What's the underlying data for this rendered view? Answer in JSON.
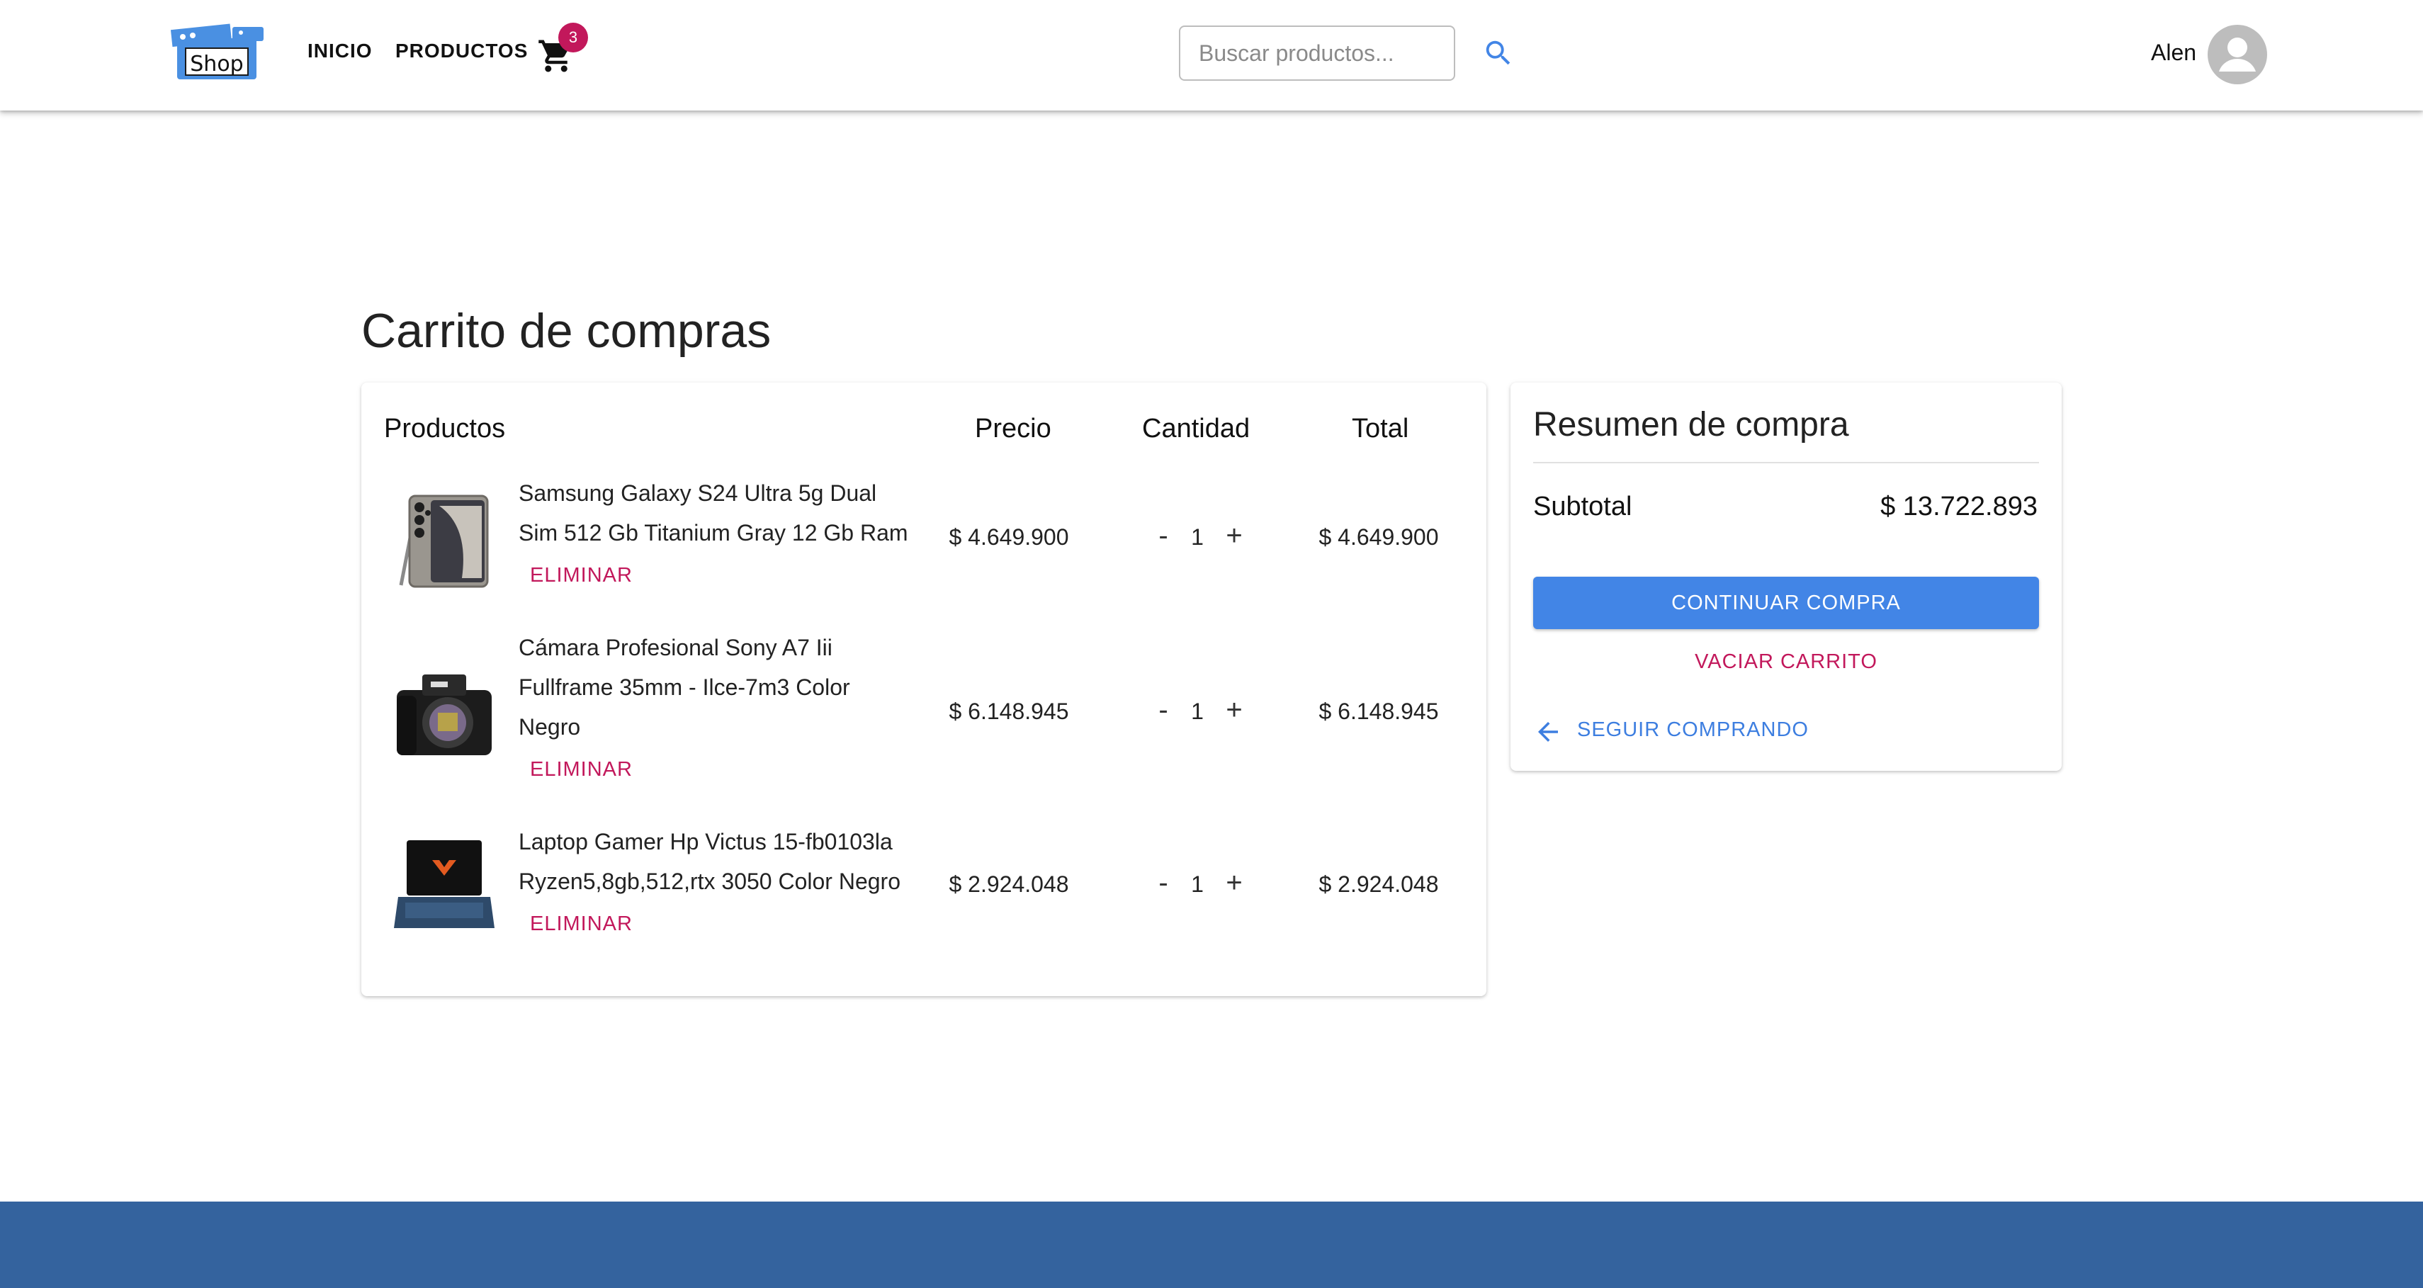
{
  "header": {
    "logo_text": "Shop",
    "nav": [
      {
        "label": "INICIO"
      },
      {
        "label": "PRODUCTOS"
      }
    ],
    "cart_count": "3",
    "search": {
      "placeholder": "Buscar productos...",
      "value": ""
    },
    "user_name": "Alen",
    "icons": {
      "cart": "shopping-cart-icon",
      "search": "search-icon",
      "avatar": "account-circle-icon"
    }
  },
  "page_title": "Carrito de compras",
  "cart_table": {
    "headers": {
      "product": "Productos",
      "price": "Precio",
      "quantity": "Cantidad",
      "total": "Total"
    },
    "remove_label": "ELIMINAR",
    "decrement_label": "-",
    "increment_label": "+",
    "items": [
      {
        "name": "Samsung Galaxy S24 Ultra 5g Dual Sim 512 Gb Titanium Gray 12 Gb Ram",
        "price": "$ 4.649.900",
        "quantity": "1",
        "total": "$ 4.649.900",
        "image": "phone-image"
      },
      {
        "name": "Cámara Profesional Sony A7 Iii Fullframe 35mm - Ilce-7m3 Color Negro",
        "price": "$ 6.148.945",
        "quantity": "1",
        "total": "$ 6.148.945",
        "image": "camera-image"
      },
      {
        "name": "Laptop Gamer Hp Victus 15-fb0103la Ryzen5,8gb,512,rtx 3050 Color Negro",
        "price": "$ 2.924.048",
        "quantity": "1",
        "total": "$ 2.924.048",
        "image": "laptop-image"
      }
    ]
  },
  "summary": {
    "title": "Resumen de compra",
    "subtotal_label": "Subtotal",
    "subtotal_value": "$ 13.722.893",
    "continue_label": "CONTINUAR COMPRA",
    "empty_label": "VACIAR CARRITO",
    "back_label": "SEGUIR COMPRANDO"
  },
  "colors": {
    "primary": "#4285e6",
    "danger": "#c2185b",
    "footer": "#34639e",
    "link": "#3d7ee0"
  }
}
